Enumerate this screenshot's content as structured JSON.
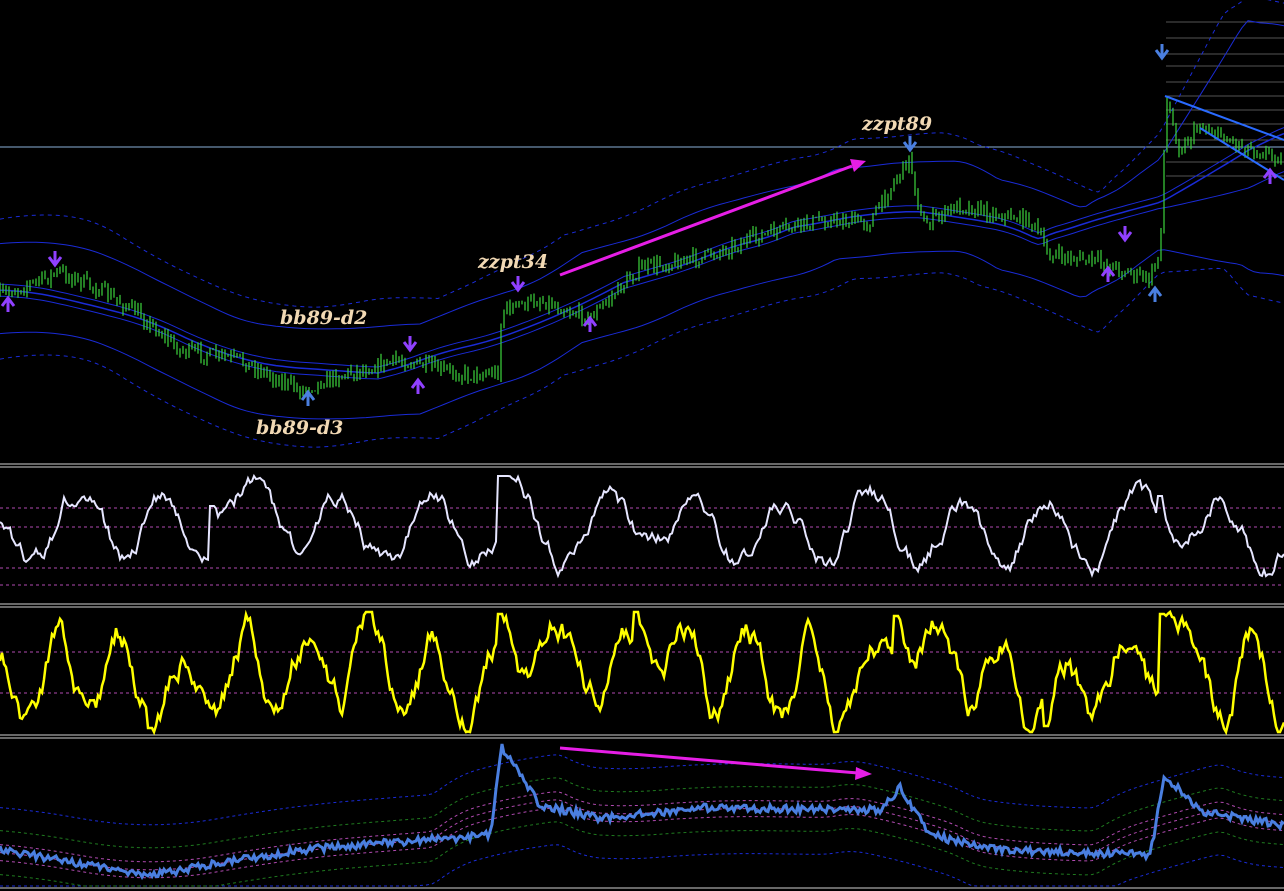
{
  "colors": {
    "background": "#000000",
    "price": "#3cd43c",
    "bands": "#1a2bd6",
    "annotation_text": "#f2d9b4",
    "arrow": "#e61ee6",
    "rsi": "#e6e6ff",
    "stoch": "#ffff00",
    "bottom_line": "#4a7fe0",
    "level_dash": "#b04ab0",
    "trendline": "#2a6bff",
    "hline": "#8ab0d8",
    "signal_up": "#9040ff",
    "signal_down": "#4a7fe0"
  },
  "annotations": {
    "zzpt89": "zzpt89",
    "zzpt34": "zzpt34",
    "bb89_d2": "bb89-d2",
    "bb89_d3": "bb89-d3"
  },
  "chart_data": [
    {
      "type": "line",
      "panel": "price",
      "x": [
        0,
        60,
        120,
        180,
        240,
        300,
        360,
        420,
        470,
        500,
        520,
        560,
        600,
        640,
        700,
        760,
        820,
        870,
        900,
        915,
        940,
        980,
        1020,
        1060,
        1100,
        1150,
        1165,
        1200,
        1240,
        1284
      ],
      "series": [
        {
          "values": [
            100,
            104,
            100,
            95,
            92,
            88,
            93,
            96,
            98,
            97,
            105,
            106,
            104,
            108,
            112,
            115,
            117,
            120,
            126,
            117,
            119,
            118,
            116,
            112,
            111,
            110,
            135,
            130,
            126,
            128
          ]
        }
      ],
      "grid": false
    },
    {
      "type": "line",
      "panel": "oscillator-1",
      "series": [
        {
          "values": []
        }
      ]
    },
    {
      "type": "line",
      "panel": "oscillator-2",
      "series": [
        {
          "values": []
        }
      ]
    },
    {
      "type": "line",
      "panel": "oscillator-3",
      "series": [
        {
          "values": []
        }
      ]
    }
  ]
}
